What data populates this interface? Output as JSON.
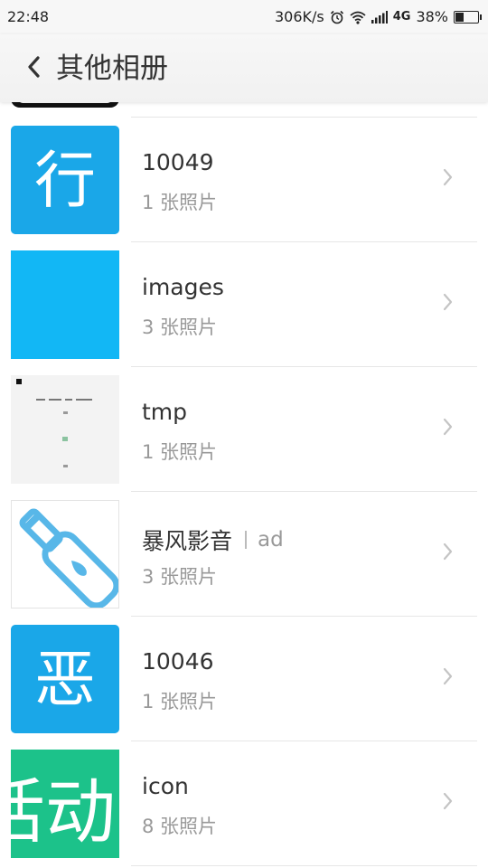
{
  "status_bar": {
    "time": "22:48",
    "speed": "306K/s",
    "network": "4G",
    "battery": "38%",
    "battery_level": 0.38,
    "icons": [
      "alarm-icon",
      "wifi-icon",
      "signal-icon",
      "battery-icon"
    ]
  },
  "header": {
    "title": "其他相册",
    "back_icon": "chevron-left-icon"
  },
  "albums": [
    {
      "name": "10049",
      "count": "1 张照片",
      "thumb": "blue-xing-char",
      "glyph": "行"
    },
    {
      "name": "images",
      "count": "3 张照片",
      "thumb": "solid-blue"
    },
    {
      "name": "tmp",
      "count": "1 张照片",
      "thumb": "screenshot-white"
    },
    {
      "name": "暴风影音",
      "tag": "ad",
      "count": "3 张照片",
      "thumb": "blue-bottle"
    },
    {
      "name": "10046",
      "count": "1 张照片",
      "thumb": "blue-e-char",
      "glyph": "恶"
    },
    {
      "name": "icon",
      "count": "8 张照片",
      "thumb": "green-huodong",
      "glyph": "活动"
    }
  ],
  "colors": {
    "accent_blue": "#1AA7E8",
    "bright_blue": "#12B7F5",
    "green": "#1CC28A",
    "title_text": "#333333",
    "sub_text": "#999999"
  }
}
